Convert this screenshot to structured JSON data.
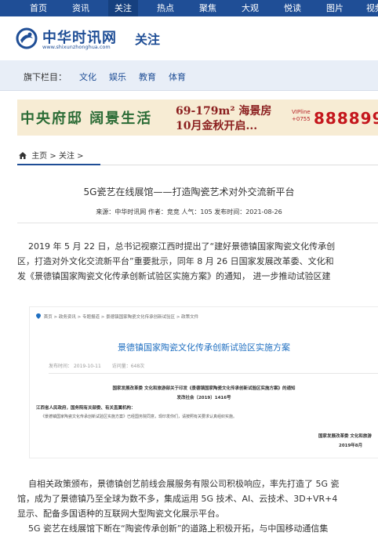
{
  "top_nav": {
    "items": [
      "首页",
      "资讯",
      "关注",
      "热点",
      "聚焦",
      "大观",
      "悦读",
      "图片",
      "视频"
    ],
    "active_index": 2
  },
  "header": {
    "logo_name": "中华时讯网",
    "logo_url": "www.shixunzhonghua.com",
    "channel": "关注"
  },
  "sub_nav": {
    "label": "旗下栏目：",
    "items": [
      "文化",
      "娱乐",
      "教育",
      "体育"
    ]
  },
  "ad": {
    "left_text": "中央府邸 阔景生活",
    "mid_line1": "69-179m² 海景房",
    "mid_line2": "10月金秋开启...",
    "vip_top": "VIPline",
    "vip_bottom": "+0755",
    "phone": "888899"
  },
  "breadcrumb": {
    "home": "主页",
    "sep": ">",
    "current": "关注",
    "tail": ">"
  },
  "article": {
    "title": "5G瓷艺在线展馆——打造陶瓷艺术对外交流新平台",
    "meta": "来源：中华时讯网 作者：竞竞 人气：105 发布时间：2021-08-26",
    "para1": [
      "2019 年 5 月 22 日，总书记视察江西时提出了“建好景德镇国家陶瓷文化传承创",
      "区，打造对外文化交流新平台”重要批示，同年 8 月 26 日国家发展改革委、文化和",
      "发《景德镇国家陶瓷文化传承创新试验区实施方案》的通知， 进一步推动试验区建"
    ],
    "para2": [
      "自相关政策颁布，景德镇创艺前线会展服务有限公司积极响应，率先打造了 5G 瓷",
      "馆，成为了景德镇乃至全球为数不多，集成运用 5G 技术、AI、云技术、3D+VR+4",
      "显示、配备多国语种的互联网大型陶瓷文化展示平台。",
      "5G 瓷艺在线展馆下断在“陶瓷传承创新”的道路上积极开拓，与中国移动通信集"
    ]
  },
  "embedded": {
    "crumb": "首页 > 政务资讯 > 专题报道 > 景德镇国家陶瓷文化传承创新试验区 > 政策文件",
    "title": "景德镇国家陶瓷文化传承创新试验区实施方案",
    "publish_label": "发布时间：",
    "publish_date": "2019-10-11",
    "views": "访问量：648次",
    "line1": "国家发展改革委 文化和旅游部关于印发《景德镇国家陶瓷文化传承创新试验区实施方案》的通知",
    "line2": "发改社会〔2019〕1416号",
    "line3": "江西省人民政府，国务院有关部委、有关直属机构：",
    "line4": "《景德镇国家陶瓷文化传承创新试验区实施方案》已经国务院同意，现印发你们，请按照有关要求认真组织实施。",
    "right1": "国家发展改革委 文化和旅游",
    "right2": "2019年8月"
  },
  "colors": {
    "nav_bg": "#1f4e96",
    "brand": "#1f4e96",
    "link": "#1f6fc1",
    "ad_phone": "#c4161c"
  }
}
